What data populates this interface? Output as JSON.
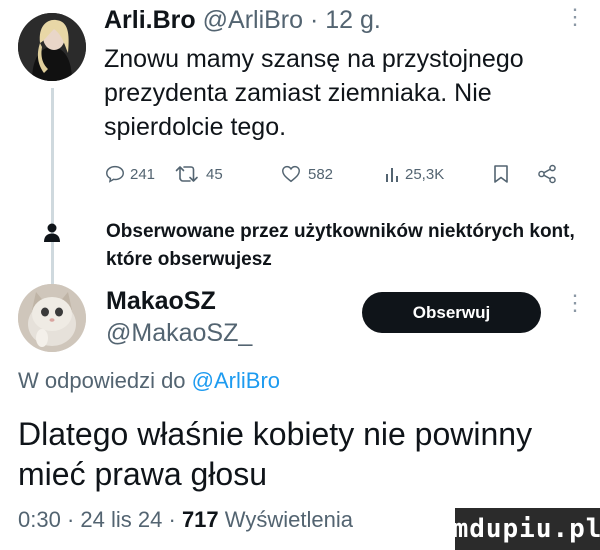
{
  "tweet1": {
    "name": "Arli.Bro",
    "handle": "@ArliBro",
    "separator": " · ",
    "time": "12 g.",
    "text": "Znowu mamy szansę na przystojnego prezydenta zamiast ziemniaka. Nie spierdolcie tego.",
    "stats": {
      "replies": "241",
      "retweets": "45",
      "likes": "582",
      "views": "25,3K"
    }
  },
  "followed_notice": "Obserwowane przez użytkowników niektórych kont, które obserwujesz",
  "tweet2": {
    "name": "MakaoSZ",
    "handle": "@MakaoSZ_",
    "follow_label": "Obserwuj",
    "reply_prefix": "W odpowiedzi do ",
    "reply_to": "@ArliBro",
    "text": "Dlatego właśnie kobiety nie powinny mieć prawa głosu",
    "time": "0:30",
    "date": "24 lis 24",
    "views_count": "717",
    "views_label": "Wyświetlenia"
  },
  "watermark": "mdupiu.pl",
  "colors": {
    "text": "#0f1419",
    "muted": "#536471",
    "link": "#1d9bf0",
    "button": "#0f1419"
  }
}
